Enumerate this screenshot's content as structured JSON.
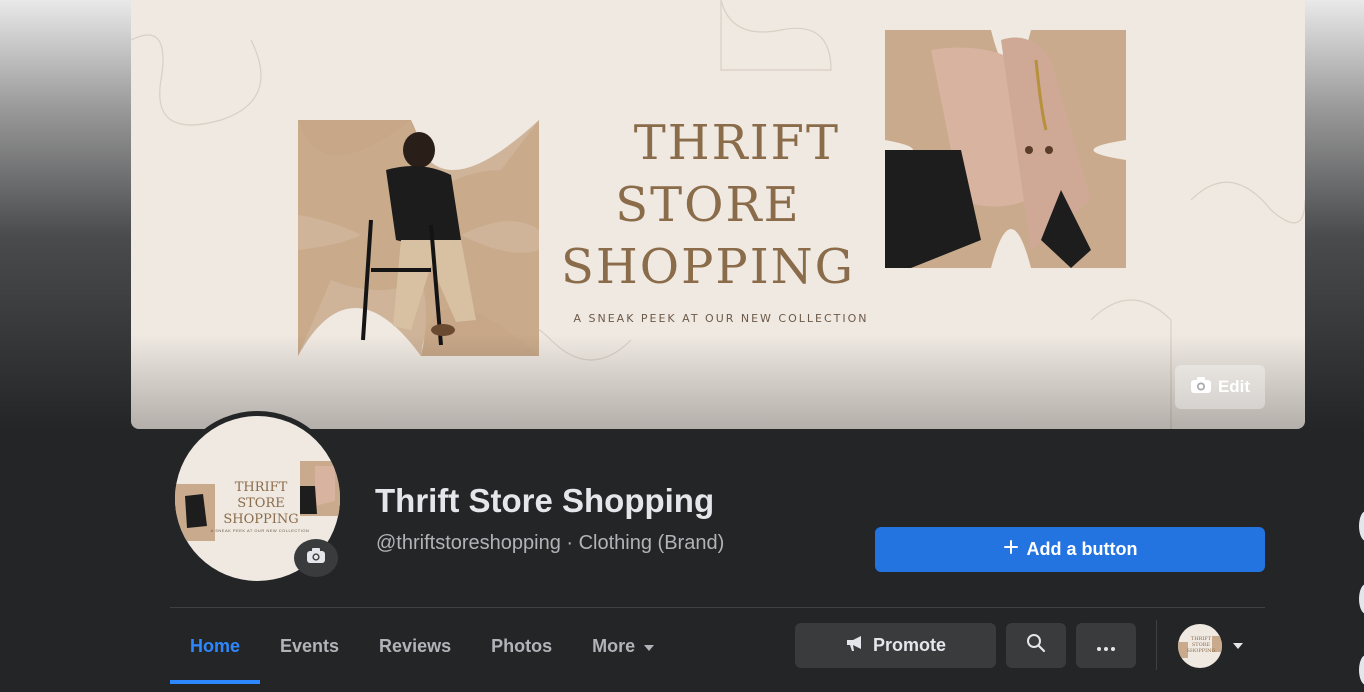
{
  "cover": {
    "title_line1": "THRIFT",
    "title_line2": "STORE",
    "title_line3": "SHOPPING",
    "subtitle": "A SNEAK PEEK AT OUR NEW COLLECTION",
    "edit_label": "Edit"
  },
  "avatar": {
    "title_line1": "THRIFT",
    "title_line2": "STORE",
    "title_line3": "SHOPPING",
    "subtitle": "A SNEAK PEEK AT OUR NEW COLLECTION"
  },
  "page": {
    "name": "Thrift Store Shopping",
    "meta": "@thriftstoreshopping · Clothing (Brand)"
  },
  "actions": {
    "add_button": "Add a button",
    "promote": "Promote"
  },
  "tabs": [
    {
      "label": "Home",
      "active": true
    },
    {
      "label": "Events"
    },
    {
      "label": "Reviews"
    },
    {
      "label": "Photos"
    },
    {
      "label": "More"
    }
  ],
  "icons": {
    "camera": "camera-icon",
    "plus": "plus-icon",
    "megaphone": "megaphone-icon",
    "search": "search-icon",
    "more": "more-dots-icon",
    "caret": "caret-down-icon"
  },
  "colors": {
    "accent": "#2d88ff",
    "primary_button": "#2374e1",
    "panel": "#242526",
    "cover_text": "#8a6c4a"
  }
}
